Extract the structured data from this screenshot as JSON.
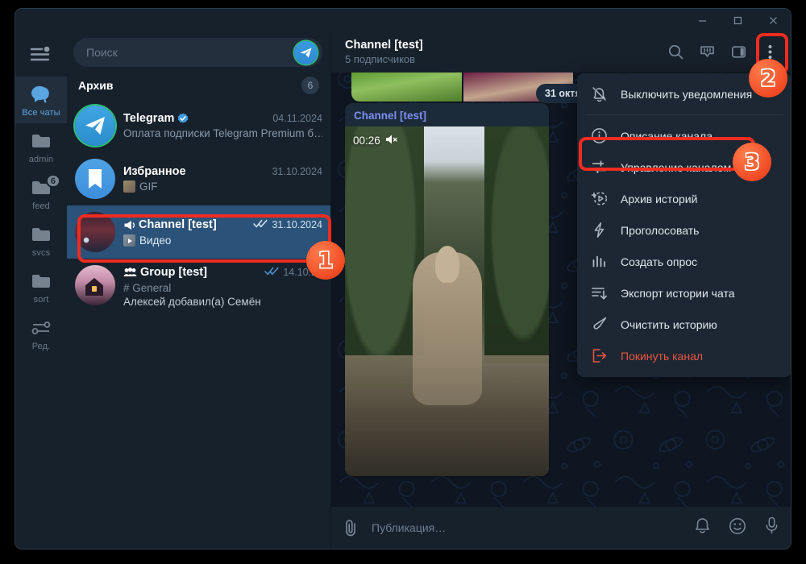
{
  "window": {
    "controls": {
      "minimize": "minimize-icon",
      "maximize": "maximize-icon",
      "close": "close-icon"
    }
  },
  "rail": {
    "burger_icon": "menu-icon",
    "folders": [
      {
        "label": "Все чаты",
        "icon": "chats-icon",
        "active": true,
        "badge": ""
      },
      {
        "label": "admin",
        "icon": "folder-icon",
        "active": false,
        "badge": ""
      },
      {
        "label": "feed",
        "icon": "folder-icon",
        "active": false,
        "badge": "6"
      },
      {
        "label": "svcs",
        "icon": "folder-icon",
        "active": false,
        "badge": ""
      },
      {
        "label": "sort",
        "icon": "folder-icon",
        "active": false,
        "badge": ""
      },
      {
        "label": "Ред.",
        "icon": "sliders-icon",
        "active": false,
        "badge": ""
      }
    ]
  },
  "search": {
    "placeholder": "Поиск",
    "tg_button_icon": "telegram-plane-icon"
  },
  "archive": {
    "title": "Архив",
    "count": "6"
  },
  "chats": [
    {
      "name": "Telegram",
      "verified": true,
      "date": "04.11.2024",
      "preview": "Оплата подписки Telegram Premium б…",
      "selected": false,
      "read_ticks": false,
      "avatar": "telegram-avatar"
    },
    {
      "name": "Избранное",
      "verified": false,
      "date": "31.10.2024",
      "preview": "GIF",
      "preview_thumb": true,
      "selected": false,
      "read_ticks": false,
      "avatar": "saved-messages-avatar"
    },
    {
      "name": "Channel [test]",
      "prefix_icon": "megaphone-icon",
      "verified": false,
      "date": "31.10.2024",
      "preview": "Видео",
      "preview_thumb": true,
      "selected": true,
      "read_ticks": true,
      "avatar": "channel-avatar"
    },
    {
      "name": "Group [test]",
      "prefix_icon": "group-icon",
      "verified": false,
      "date": "14.10.20",
      "topic": "# General",
      "preview": "Алексей добавил(а) Семён",
      "selected": false,
      "read_ticks": true,
      "avatar": "group-avatar"
    }
  ],
  "chat_header": {
    "title": "Channel [test]",
    "subtitle": "5 подписчиков",
    "actions": [
      {
        "name": "search-icon",
        "label": "Поиск"
      },
      {
        "name": "stories-icon",
        "label": "Истории"
      },
      {
        "name": "sidebar-icon",
        "label": "Панель"
      },
      {
        "name": "more-vertical-icon",
        "label": "Ещё"
      }
    ]
  },
  "conversation": {
    "date_chip": "31 октября",
    "message": {
      "author": "Channel [test]",
      "video_duration": "00:26",
      "muted_icon": "speaker-muted-icon",
      "forward_icon": "forward-icon"
    }
  },
  "composer": {
    "attach_icon": "paperclip-icon",
    "placeholder": "Публикация…",
    "icons": [
      {
        "name": "bell-icon"
      },
      {
        "name": "emoji-icon"
      },
      {
        "name": "microphone-icon"
      }
    ]
  },
  "menu": {
    "items": [
      {
        "label": "Выключить уведомления",
        "icon": "bell-muted-icon",
        "danger": false,
        "separator_after": true
      },
      {
        "label": "Описание канала",
        "icon": "info-icon",
        "danger": false
      },
      {
        "label": "Управление каналом",
        "icon": "sliders-icon",
        "danger": false,
        "highlighted": true
      },
      {
        "label": "Архив историй",
        "icon": "story-archive-icon",
        "danger": false
      },
      {
        "label": "Проголосовать",
        "icon": "boost-icon",
        "danger": false
      },
      {
        "label": "Создать опрос",
        "icon": "poll-icon",
        "danger": false
      },
      {
        "label": "Экспорт истории чата",
        "icon": "export-icon",
        "danger": false
      },
      {
        "label": "Очистить историю",
        "icon": "broom-icon",
        "danger": false
      },
      {
        "label": "Покинуть канал",
        "icon": "leave-icon",
        "danger": true
      }
    ]
  },
  "annotations": {
    "badges": [
      {
        "number": "1"
      },
      {
        "number": "2"
      },
      {
        "number": "3"
      }
    ],
    "color": "#ef2c20"
  }
}
